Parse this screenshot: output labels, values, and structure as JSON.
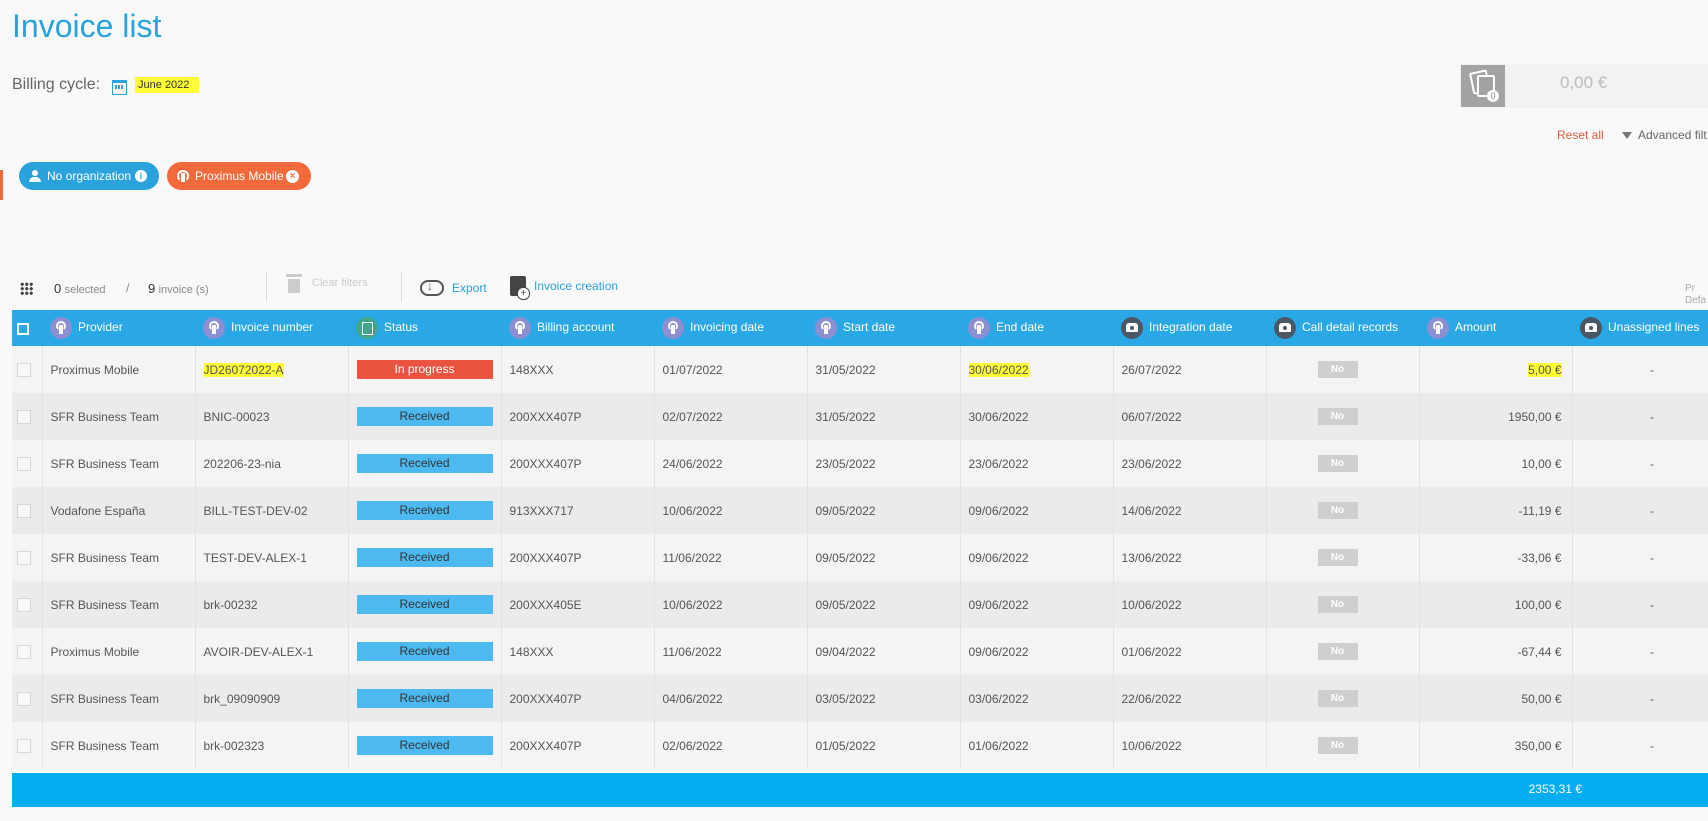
{
  "page": {
    "title": "Invoice list"
  },
  "billing": {
    "label": "Billing cycle:",
    "value": "June 2022"
  },
  "summary": {
    "count": "0",
    "amount": "0,00 €"
  },
  "filters": {
    "reset_label": "Reset all",
    "advanced_label": "Advanced filt"
  },
  "chips": [
    {
      "label": "No organization"
    },
    {
      "label": "Proximus Mobile"
    }
  ],
  "toolbar": {
    "selected_count": "0",
    "selected_label": "selected",
    "separator": "/",
    "invoice_count": "9",
    "invoice_label": "invoice (s)",
    "clear_filters": "Clear filters",
    "export": "Export",
    "invoice_creation": "Invoice creation",
    "cut_label_1": "Pr",
    "cut_label_2": "Defa"
  },
  "table": {
    "headers": [
      "Provider",
      "Invoice number",
      "Status",
      "Billing account",
      "Invoicing date",
      "Start date",
      "End date",
      "Integration date",
      "Call detail records",
      "Amount",
      "Unassigned lines"
    ],
    "rows": [
      {
        "provider": "Proximus Mobile",
        "invoice": "JD26072022-A",
        "status": "In progress",
        "account": "148XXX",
        "invoicing": "01/07/2022",
        "start": "31/05/2022",
        "end": "30/06/2022",
        "integration": "26/07/2022",
        "cdr": "No",
        "amount": "5,00 €",
        "unassigned": "-"
      },
      {
        "provider": "SFR Business Team",
        "invoice": "BNIC-00023",
        "status": "Received",
        "account": "200XXX407P",
        "invoicing": "02/07/2022",
        "start": "31/05/2022",
        "end": "30/06/2022",
        "integration": "06/07/2022",
        "cdr": "No",
        "amount": "1950,00 €",
        "unassigned": "-"
      },
      {
        "provider": "SFR Business Team",
        "invoice": "202206-23-nia",
        "status": "Received",
        "account": "200XXX407P",
        "invoicing": "24/06/2022",
        "start": "23/05/2022",
        "end": "23/06/2022",
        "integration": "23/06/2022",
        "cdr": "No",
        "amount": "10,00 €",
        "unassigned": "-"
      },
      {
        "provider": "Vodafone España",
        "invoice": "BILL-TEST-DEV-02",
        "status": "Received",
        "account": "913XXX717",
        "invoicing": "10/06/2022",
        "start": "09/05/2022",
        "end": "09/06/2022",
        "integration": "14/06/2022",
        "cdr": "No",
        "amount": "-11,19 €",
        "unassigned": "-"
      },
      {
        "provider": "SFR Business Team",
        "invoice": "TEST-DEV-ALEX-1",
        "status": "Received",
        "account": "200XXX407P",
        "invoicing": "11/06/2022",
        "start": "09/05/2022",
        "end": "09/06/2022",
        "integration": "13/06/2022",
        "cdr": "No",
        "amount": "-33,06 €",
        "unassigned": "-"
      },
      {
        "provider": "SFR Business Team",
        "invoice": "brk-00232",
        "status": "Received",
        "account": "200XXX405E",
        "invoicing": "10/06/2022",
        "start": "09/05/2022",
        "end": "09/06/2022",
        "integration": "10/06/2022",
        "cdr": "No",
        "amount": "100,00 €",
        "unassigned": "-"
      },
      {
        "provider": "Proximus Mobile",
        "invoice": "AVOIR-DEV-ALEX-1",
        "status": "Received",
        "account": "148XXX",
        "invoicing": "11/06/2022",
        "start": "09/04/2022",
        "end": "09/06/2022",
        "integration": "01/06/2022",
        "cdr": "No",
        "amount": "-67,44 €",
        "unassigned": "-"
      },
      {
        "provider": "SFR Business Team",
        "invoice": "brk_09090909",
        "status": "Received",
        "account": "200XXX407P",
        "invoicing": "04/06/2022",
        "start": "03/05/2022",
        "end": "03/06/2022",
        "integration": "22/06/2022",
        "cdr": "No",
        "amount": "50,00 €",
        "unassigned": "-"
      },
      {
        "provider": "SFR Business Team",
        "invoice": "brk-002323",
        "status": "Received",
        "account": "200XXX407P",
        "invoicing": "02/06/2022",
        "start": "01/05/2022",
        "end": "01/06/2022",
        "integration": "10/06/2022",
        "cdr": "No",
        "amount": "350,00 €",
        "unassigned": "-"
      }
    ],
    "total": "2353,31 €"
  },
  "colors": {
    "accent": "#2aa2dc",
    "header": "#2aa8e6",
    "in_progress": "#e95340",
    "received": "#4cb9f0",
    "chip_orange": "#f26a3b",
    "highlight": "#ffff33"
  },
  "icons": [
    "calendar-icon",
    "invoices-summary-icon",
    "funnel-icon",
    "user-icon",
    "info-icon",
    "antenna-icon",
    "close-icon",
    "grid-icon",
    "trash-icon",
    "cloud-download-icon",
    "document-plus-icon",
    "status-doc-icon",
    "phone-icon"
  ]
}
